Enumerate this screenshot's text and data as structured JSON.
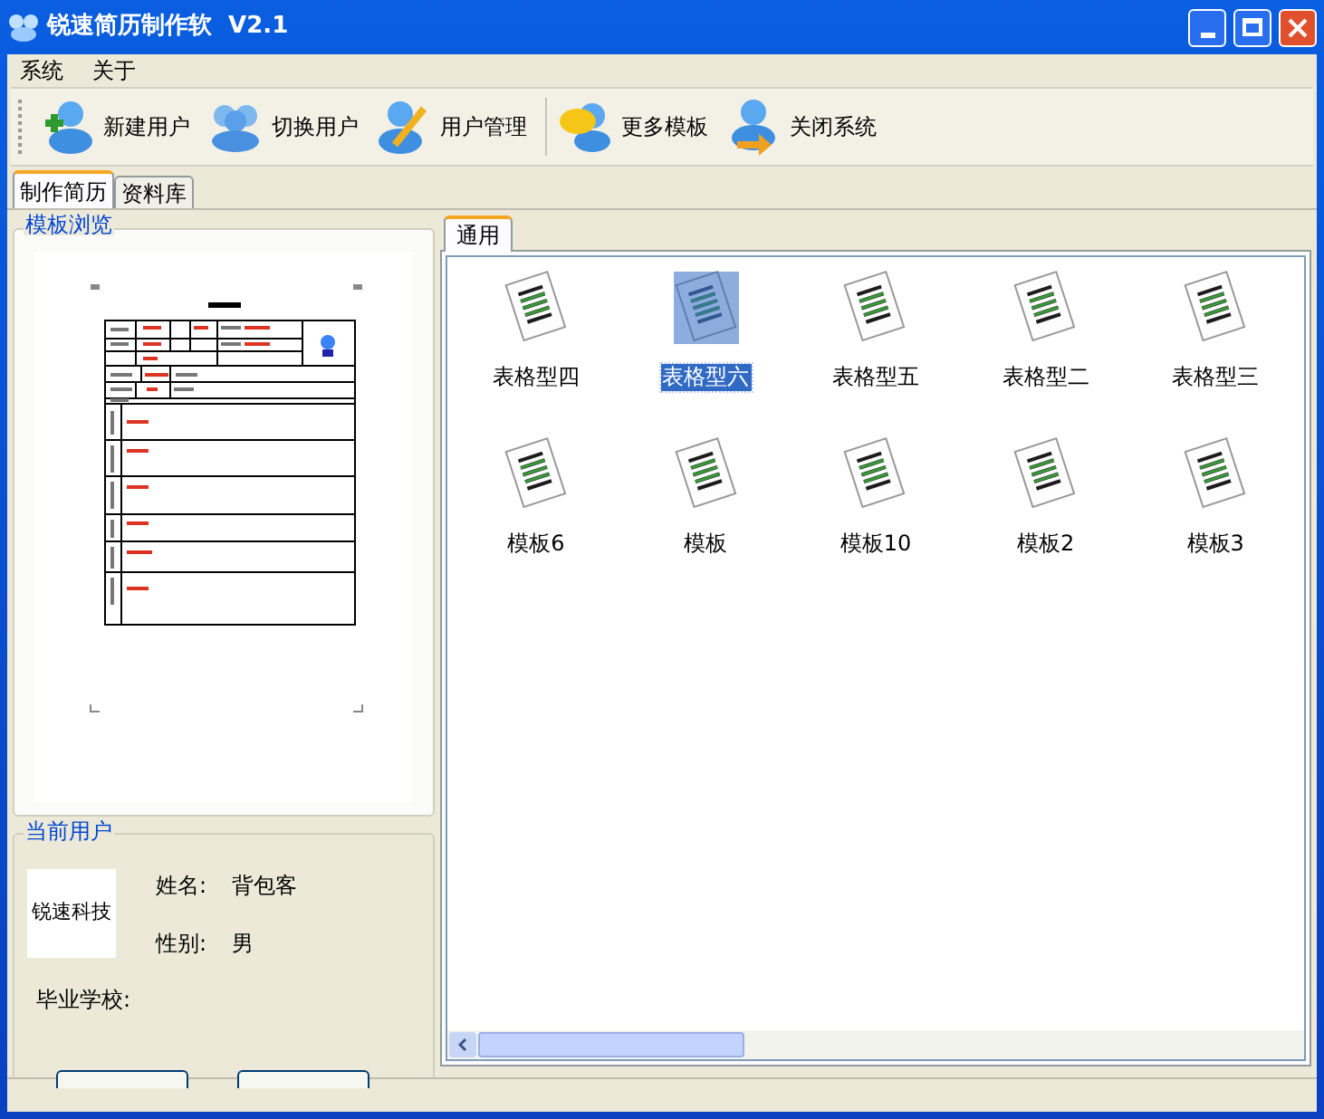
{
  "window": {
    "title": "锐速简历制作软  V2.1"
  },
  "menu": [
    "系统",
    "关于"
  ],
  "toolbar": [
    {
      "label": "新建用户",
      "kind": "add"
    },
    {
      "label": "切换用户",
      "kind": "switch"
    },
    {
      "label": "用户管理",
      "kind": "edit"
    },
    {
      "label": "更多模板",
      "kind": "chat"
    },
    {
      "label": "关闭系统",
      "kind": "exit"
    }
  ],
  "tabs": [
    {
      "label": "制作简历",
      "selected": true
    },
    {
      "label": "资料库",
      "selected": false
    }
  ],
  "preview": {
    "title": "模板浏览"
  },
  "current_user": {
    "title": "当前用户",
    "logo": "锐速科技",
    "fields": [
      {
        "label": "姓名:",
        "value": "背包客"
      },
      {
        "label": "性别:",
        "value": "男"
      },
      {
        "label": "毕业学校:"
      }
    ]
  },
  "template_tabs": [
    {
      "label": "通用",
      "selected": true
    }
  ],
  "templates": [
    {
      "label": "表格型四",
      "selected": false
    },
    {
      "label": "表格型六",
      "selected": true
    },
    {
      "label": "表格型五",
      "selected": false
    },
    {
      "label": "表格型二",
      "selected": false
    },
    {
      "label": "表格型三",
      "selected": false
    },
    {
      "label": "模板6",
      "selected": false
    },
    {
      "label": "模板",
      "selected": false
    },
    {
      "label": "模板10",
      "selected": false
    },
    {
      "label": "模板2",
      "selected": false
    },
    {
      "label": "模板3",
      "selected": false
    }
  ]
}
